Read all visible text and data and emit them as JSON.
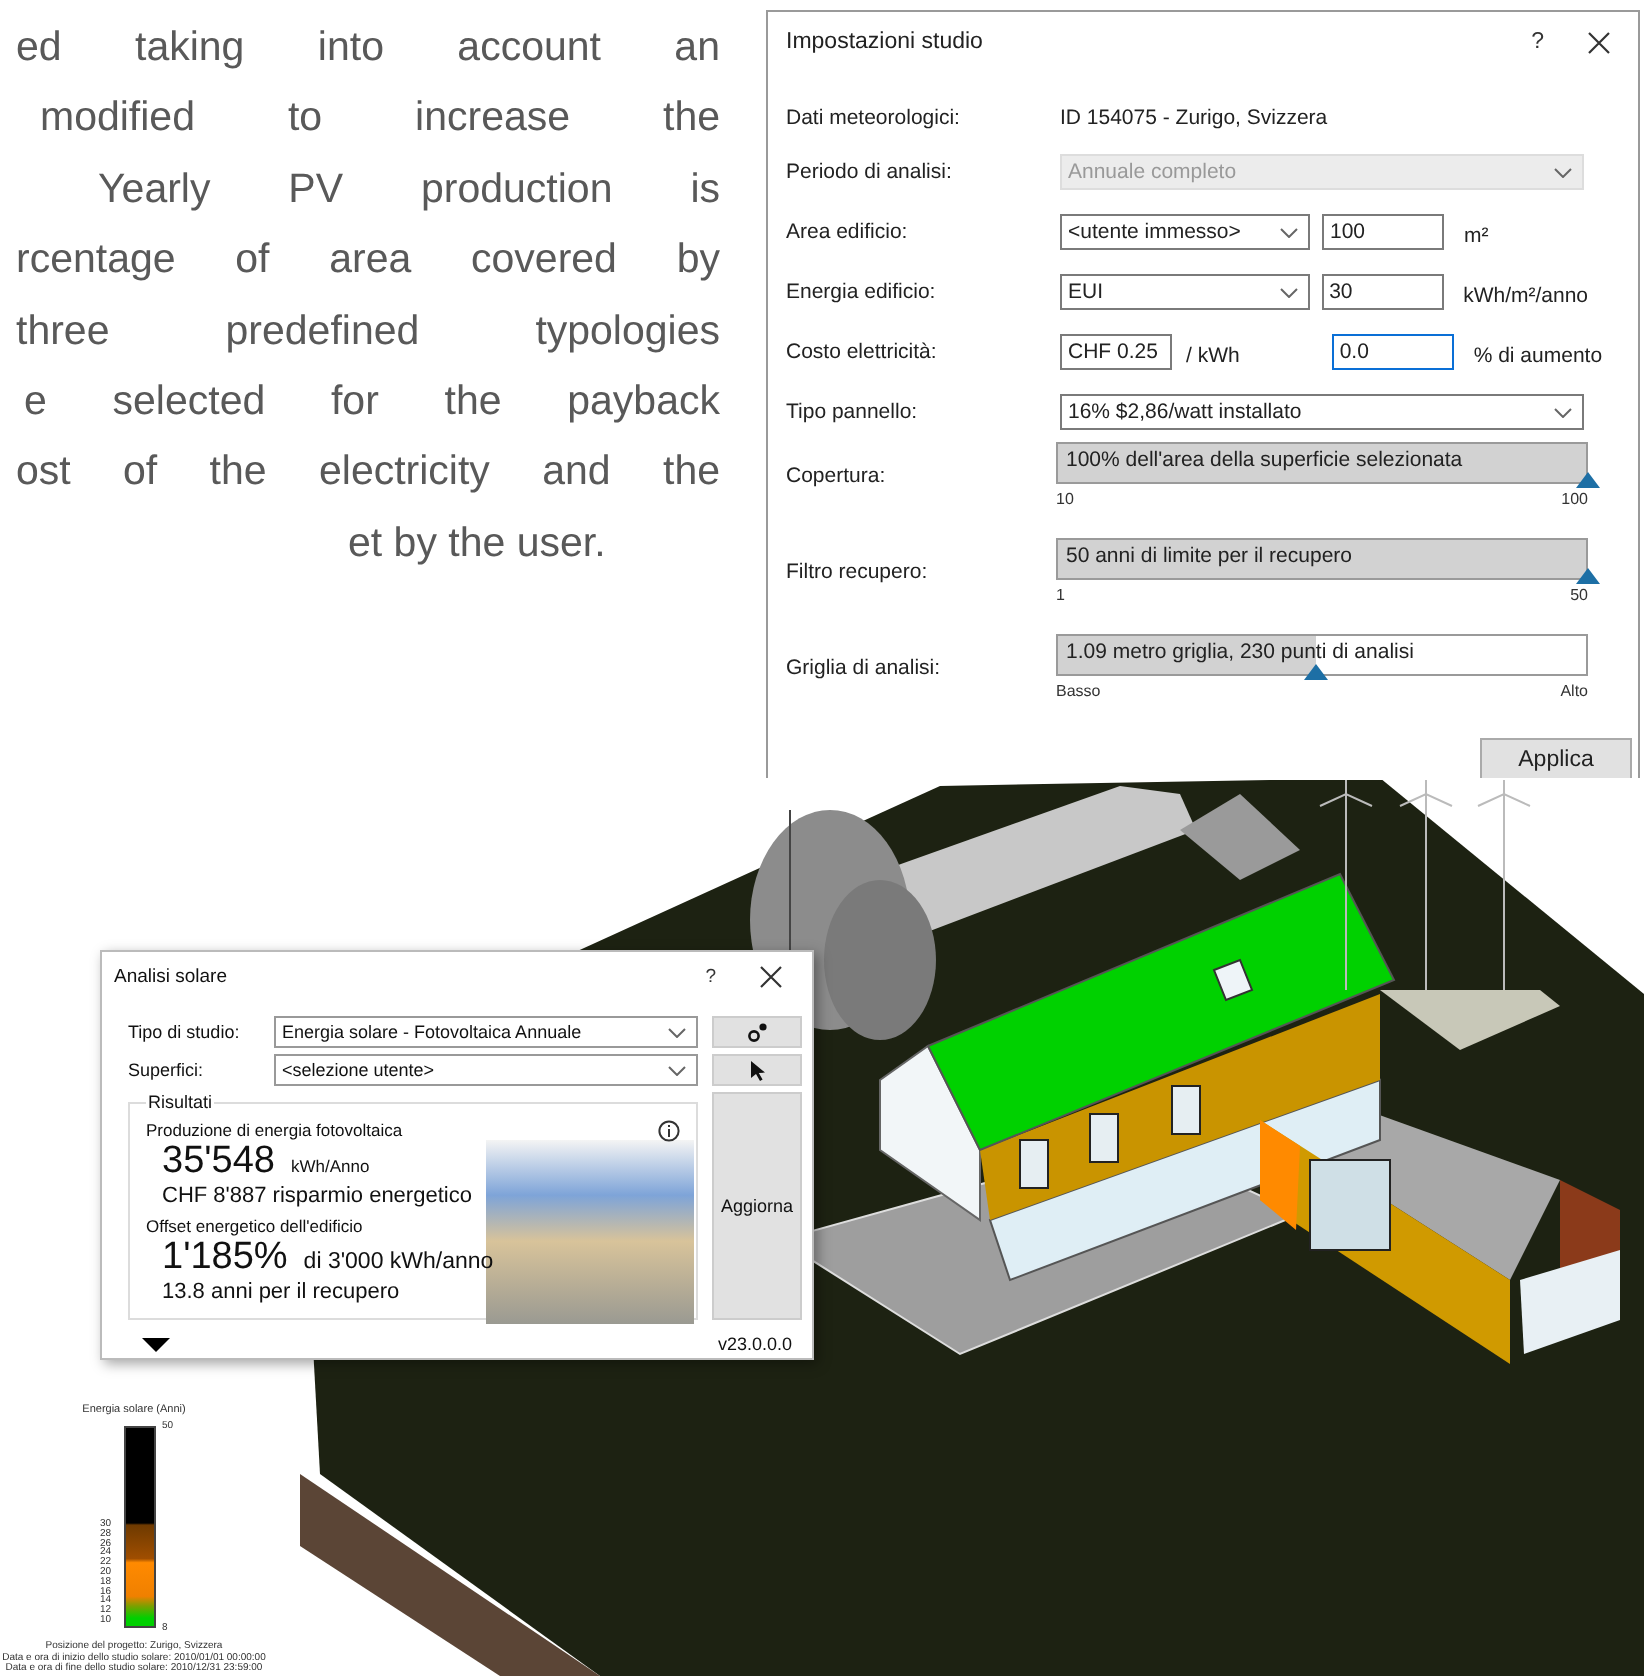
{
  "article": {
    "lines": [
      "ed taking into account an",
      "modified to increase the",
      "Yearly PV production is",
      "rcentage of area covered by",
      "three predefined typologies",
      "e selected for the payback",
      "ost of the electricity and the",
      "et by the user."
    ]
  },
  "settings_dialog": {
    "title": "Impostazioni studio",
    "help": "?",
    "rows": [
      {
        "kind": "text",
        "label": "Dati meteorologici:",
        "value": "ID 154075 - Zurigo, Svizzera"
      },
      {
        "kind": "dropdown",
        "label": "Periodo di analisi:",
        "value": "Annuale completo",
        "disabled": true
      },
      {
        "kind": "dropdown_input",
        "label": "Area edificio:",
        "dropdown": {
          "value": "<utente immesso>",
          "disabled": false
        },
        "input": {
          "value": "100",
          "focused": false
        },
        "unit": "m²"
      },
      {
        "kind": "dropdown_input",
        "label": "Energia edificio:",
        "dropdown": {
          "value": "EUI",
          "disabled": false
        },
        "input": {
          "value": "30",
          "focused": false
        },
        "unit": "kWh/m²/anno"
      },
      {
        "kind": "cost",
        "label": "Costo elettricità:",
        "price": {
          "value": "CHF 0.25",
          "focused": false
        },
        "per": "/ kWh",
        "input": {
          "value": "0.0",
          "focused": true
        },
        "unit": "% di aumento"
      },
      {
        "kind": "dropdown",
        "label": "Tipo pannello:",
        "value": "16% $2,86/watt installato",
        "disabled": false
      },
      {
        "kind": "slider",
        "label": "Copertura:",
        "text": "100% dell'area della superficie selezionata",
        "level": 1.0,
        "min_label": "10",
        "max_label": "100"
      },
      {
        "kind": "slider",
        "label": "Filtro recupero:",
        "text": "50 anni di limite per il recupero",
        "level": 1.0,
        "min_label": "1",
        "max_label": "50"
      },
      {
        "kind": "slider",
        "label": "Griglia di analisi:",
        "text": "1.09 metro griglia, 230 punti di analisi",
        "level": 0.49,
        "min_label": "Basso",
        "max_label": "Alto"
      }
    ],
    "apply": "Applica"
  },
  "solar_dialog": {
    "title": "Analisi solare",
    "help": "?",
    "study_type": {
      "label": "Tipo di studio:",
      "value": "Energia solare - Fotovoltaica Annuale"
    },
    "surfaces": {
      "label": "Superfici:",
      "value": "<selezione utente>"
    },
    "results": {
      "title": "Risultati",
      "production_label": "Produzione di energia fotovoltaica",
      "production_value": "35'548",
      "production_unit": "kWh/Anno",
      "savings": "CHF 8'887 risparmio energetico",
      "offset_label": "Offset energetico dell'edificio",
      "offset_value": "1'185%",
      "offset_detail": "di 3'000 kWh/anno",
      "payback": "13.8 anni per il recupero"
    },
    "update": "Aggiorna",
    "version": "v23.0.0.0"
  },
  "legend": {
    "title": "Energia solare (Anni)",
    "top_label": "50",
    "bottom_label": "8",
    "ticks": [
      "30",
      "28",
      "26",
      "24",
      "22",
      "20",
      "18",
      "16",
      "14",
      "12",
      "10"
    ],
    "footer": [
      "Posizione del progetto: Zurigo, Svizzera",
      "Data e ora di inizio dello studio solare: 2010/01/01 00:00:00",
      "Data e ora di fine dello studio solare: 2010/12/31 23:59:00"
    ]
  }
}
